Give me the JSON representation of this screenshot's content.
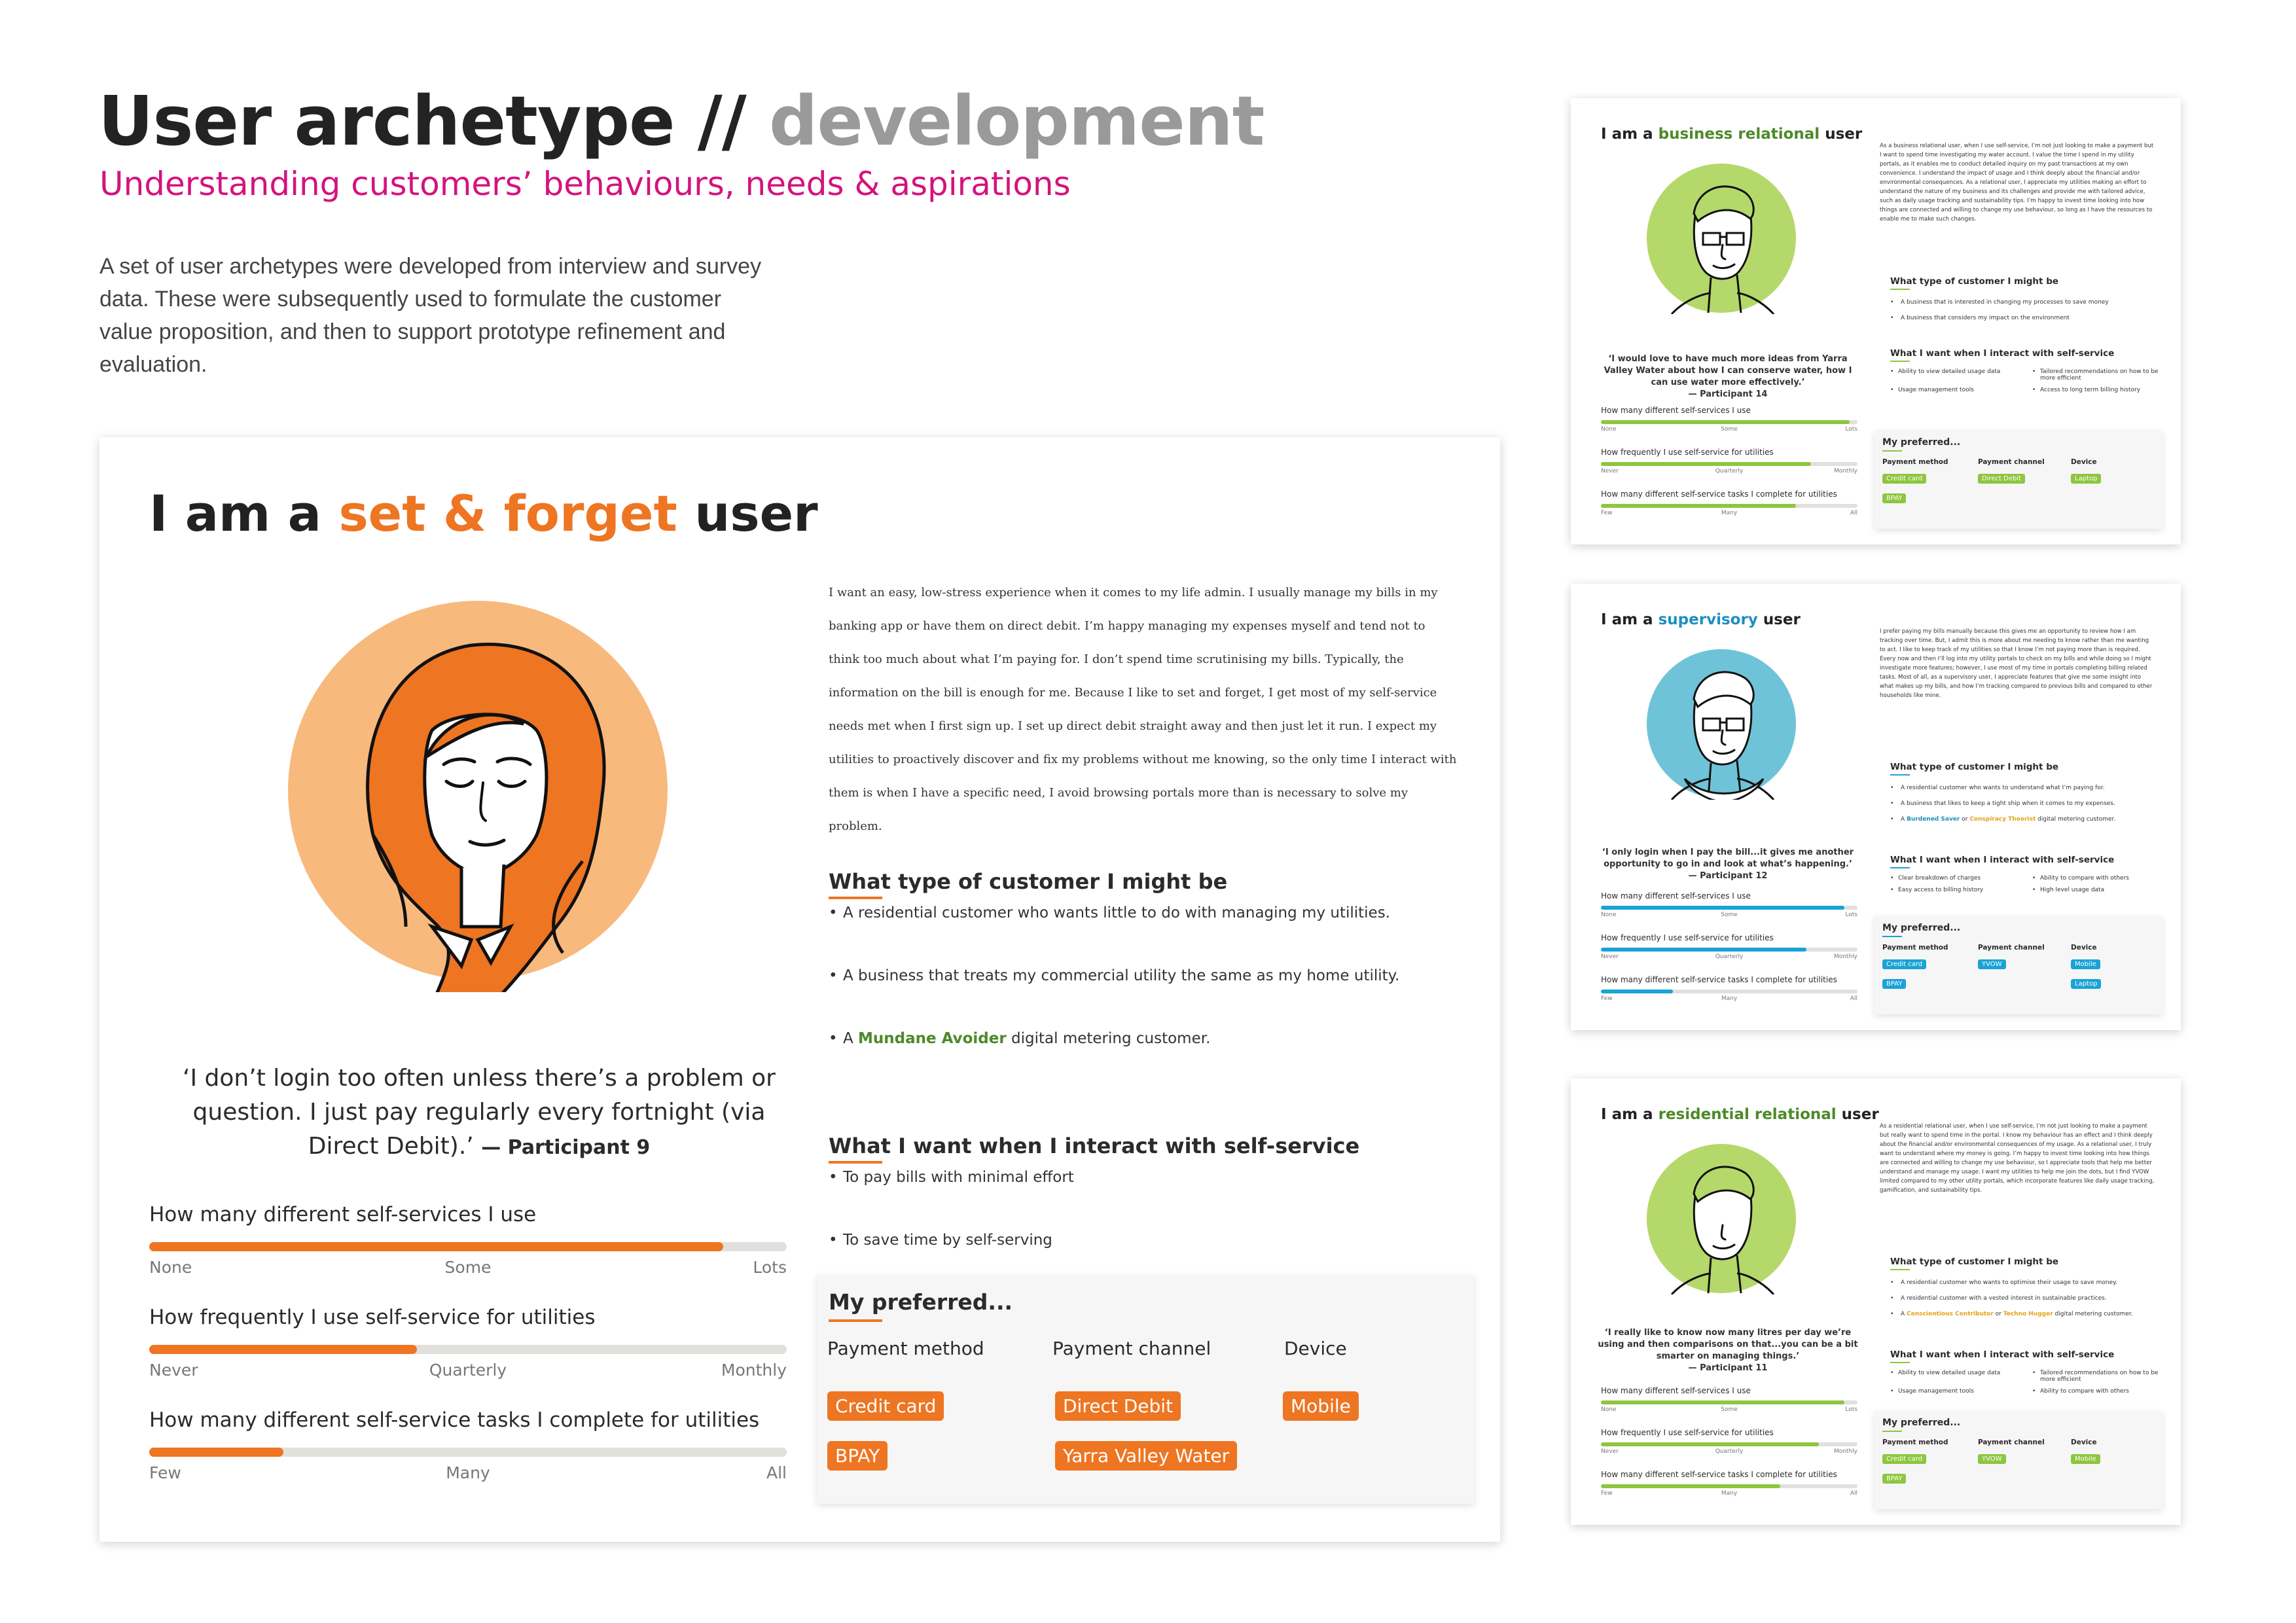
{
  "header": {
    "title_main": "User archetype //",
    "title_accent": "development",
    "subtitle": "Understanding customers’ behaviours, needs & aspirations",
    "intro": "A set of user archetypes were developed from interview and survey data. These were subsequently used to formulate the customer value proposition, and then to support prototype refinement and evaluation."
  },
  "colors": {
    "orange": "#ee7522",
    "orange_light": "#f8b97d",
    "green": "#8dc63f",
    "green_light": "#b5d86a",
    "blue": "#1aa3d6",
    "blue_light": "#6fc3d9",
    "magenta": "#d4137e"
  },
  "main_card": {
    "title_pre": "I am a",
    "title_accent": "set & forget",
    "title_post": "user",
    "portrait_icon": "woman-portrait-illustration",
    "quote": "‘I don’t login too often unless there’s a problem or question. I just pay regularly every fortnight (via Direct Debit).’",
    "quote_attr": "— Participant 9",
    "story": "I want an easy, low-stress experience when it comes to my life admin. I usually manage my bills in my banking app or have them on direct debit. I’m happy managing my expenses myself and tend not to think too much about what I’m paying for. I don’t spend time scrutinising my bills. Typically, the information on the bill is enough for me. Because I like to set and forget, I get most of my self-service needs met when I first sign up. I set up direct debit straight away and then just let it run. I expect my utilities to proactively discover and fix my problems without me knowing, so the only time I interact with them is when I have a specific need, I avoid browsing portals more than is necessary to solve my problem.",
    "type_heading": "What type of customer I might be",
    "type_items": [
      "A residential customer who wants little to do with managing my utilities.",
      "A business that treats my commercial utility the same as my home utility."
    ],
    "type_item3_pre": "A",
    "type_item3_hl": "Mundane Avoider",
    "type_item3_post": "digital metering customer.",
    "want_heading": "What I want when I interact with self-service",
    "want_items": [
      "To pay bills with minimal effort",
      "To save time by self-serving"
    ],
    "bars": [
      {
        "question": "How many different self-services I use",
        "value": 0.9,
        "ticks": [
          "None",
          "Some",
          "Lots"
        ]
      },
      {
        "question": "How frequently I use self-service for utilities",
        "value": 0.42,
        "ticks": [
          "Never",
          "Quarterly",
          "Monthly"
        ]
      },
      {
        "question": "How many different self-service tasks I complete for utilities",
        "value": 0.21,
        "ticks": [
          "Few",
          "Many",
          "All"
        ]
      }
    ],
    "preferred": {
      "heading": "My preferred...",
      "payment_method": {
        "label": "Payment method",
        "chips": [
          "Credit card",
          "BPAY"
        ]
      },
      "payment_channel": {
        "label": "Payment channel",
        "chips": [
          "Direct Debit",
          "Yarra Valley Water"
        ]
      },
      "device": {
        "label": "Device",
        "chips": [
          "Mobile"
        ]
      }
    }
  },
  "side_cards": [
    {
      "title_pre": "I am a",
      "title_accent": "business relational",
      "title_post": "user",
      "portrait_icon": "man-glasses-portrait-illustration",
      "story": "As a business relational user, when I use self-service, I’m not just looking to make a payment but I want to spend time investigating my water account. I value the time I spend in my utility portals, as it enables me to conduct detailed inquiry on my past transactions at my own convenience. I understand the impact of usage and I think deeply about the financial and/or environmental consequences. As a relational user, I appreciate my utilities making an effort to understand the nature of my business and its challenges and provide me with tailored advice, such as daily usage tracking and sustainability tips. I’m happy to invest time looking into how things are connected and willing to change my use behaviour, so long as I have the resources to enable me to make such changes.",
      "quote": "‘I would love to have much more ideas from Yarra Valley Water about how I can conserve water, how I can use water more effectively.’",
      "quote_attr": "— Participant 14",
      "type_heading": "What type of customer I might be",
      "type_items": [
        "A business that is interested in changing my processes to save money",
        "A business that considers my impact on the environment"
      ],
      "want_heading": "What I want when I interact with self-service",
      "want_items": [
        "Ability to view detailed usage data",
        "Tailored recommendations on how to be more efficient",
        "Usage management tools",
        "Access to long term billing history"
      ],
      "bars": [
        {
          "question": "How many different self-services I use",
          "value": 0.97,
          "ticks": [
            "None",
            "Some",
            "Lots"
          ]
        },
        {
          "question": "How frequently I use self-service for utilities",
          "value": 0.82,
          "ticks": [
            "Never",
            "Quarterly",
            "Monthly"
          ]
        },
        {
          "question": "How many different self-service tasks I complete for utilities",
          "value": 0.76,
          "ticks": [
            "Few",
            "Many",
            "All"
          ]
        }
      ],
      "preferred_heading": "My preferred...",
      "pm_label": "Payment method",
      "pc_label": "Payment channel",
      "dv_label": "Device",
      "pm_chips": [
        "Credit card",
        "BPAY"
      ],
      "pc_chips": [
        "Direct Debit"
      ],
      "dv_chips": [
        "Laptop"
      ]
    },
    {
      "title_pre": "I am a",
      "title_accent": "supervisory",
      "title_post": "user",
      "portrait_icon": "man-glasses-scarf-portrait-illustration",
      "story": "I prefer paying my bills manually because this gives me an opportunity to review how I am tracking over time. But, I admit this is more about me needing to know rather than me wanting to act. I like to keep track of my utilities so that I know I’m not paying more than is required. Every now and then I’ll log into my utility portals to check on my bills and while doing so I might investigate more features; however, I use most of my time in portals completing billing related tasks. Most of all, as a supervisory user, I appreciate features that give me some insight into what makes up my bills, and how I’m tracking compared to previous bills and compared to other households like mine.",
      "quote": "‘I only login when I pay the bill...it gives me another opportunity to go in and look at what’s happening.’",
      "quote_attr": "— Participant 12",
      "type_heading": "What type of customer I might be",
      "type_items": [
        "A residential customer who wants to understand what I’m paying for.",
        "A business that likes to keep a tight ship when it comes to my expenses."
      ],
      "type_item3_pre": "A",
      "type_item3_hl": "Burdened Saver",
      "type_item3_mid": "or",
      "type_item3_hl2": "Conspiracy Theorist",
      "type_item3_post": "digital metering customer.",
      "want_heading": "What I want when I interact with self-service",
      "want_items": [
        "Clear breakdown of charges",
        "Ability to compare with others",
        "Easy access to billing history",
        "High level usage data"
      ],
      "bars": [
        {
          "question": "How many different self-services I use",
          "value": 0.95,
          "ticks": [
            "None",
            "Some",
            "Lots"
          ]
        },
        {
          "question": "How frequently I use self-service for utilities",
          "value": 0.8,
          "ticks": [
            "Never",
            "Quarterly",
            "Monthly"
          ]
        },
        {
          "question": "How many different self-service tasks I complete for utilities",
          "value": 0.28,
          "ticks": [
            "Few",
            "Many",
            "All"
          ]
        }
      ],
      "preferred_heading": "My preferred...",
      "pm_label": "Payment method",
      "pc_label": "Payment channel",
      "dv_label": "Device",
      "pm_chips": [
        "Credit card",
        "BPAY"
      ],
      "pc_chips": [
        "YVOW"
      ],
      "dv_chips": [
        "Mobile",
        "Laptop"
      ]
    },
    {
      "title_pre": "I am a",
      "title_accent": "residential relational",
      "title_post": "user",
      "portrait_icon": "man-portrait-illustration",
      "story": "As a residential relational user, when I use self-service, I’m not just looking to make a payment but really want to spend time in the portal. I know my behaviour has an effect and I think deeply about the financial and/or environmental consequences of my usage. As a relational user, I truly want to understand where my money is going. I’m happy to invest time looking into how things are connected and willing to change my use behaviour, so I appreciate tools that help me better understand and manage my usage. I want my utilities to help me join the dots, but I find YVOW limited compared to my other utility portals, which incorporate features like daily usage tracking, gamification, and sustainability tips.",
      "quote": "‘I really like to know now many litres per day we’re using and then comparisons on that...you can be a bit smarter on managing things.’",
      "quote_attr": "— Participant 11",
      "type_heading": "What type of customer I might be",
      "type_items": [
        "A residential customer who wants to optimise their usage to save money.",
        "A residential customer with a vested interest in sustainable practices."
      ],
      "type_item3_pre": "A",
      "type_item3_hl": "Conscientious Contributor",
      "type_item3_mid": "or",
      "type_item3_hl2": "Techno Hugger",
      "type_item3_post": "digital metering customer.",
      "want_heading": "What I want when I interact with self-service",
      "want_items": [
        "Ability to view detailed usage data",
        "Tailored recommendations on how to be more efficient",
        "Usage management tools",
        "Ability to compare with others"
      ],
      "bars": [
        {
          "question": "How many different self-services I use",
          "value": 0.95,
          "ticks": [
            "None",
            "Some",
            "Lots"
          ]
        },
        {
          "question": "How frequently I use self-service for utilities",
          "value": 0.85,
          "ticks": [
            "Never",
            "Quarterly",
            "Monthly"
          ]
        },
        {
          "question": "How many different self-service tasks I complete for utilities",
          "value": 0.7,
          "ticks": [
            "Few",
            "Many",
            "All"
          ]
        }
      ],
      "preferred_heading": "My preferred...",
      "pm_label": "Payment method",
      "pc_label": "Payment channel",
      "dv_label": "Device",
      "pm_chips": [
        "Credit card",
        "BPAY"
      ],
      "pc_chips": [
        "YVOW"
      ],
      "dv_chips": [
        "Mobile"
      ]
    }
  ]
}
